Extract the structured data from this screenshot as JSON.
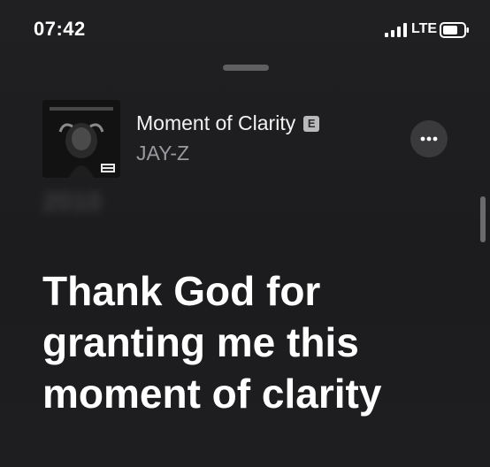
{
  "status_bar": {
    "time": "07:42",
    "network": "LTE",
    "signal_icon": "signal-bars-icon",
    "battery_icon": "battery-icon"
  },
  "now_playing": {
    "title": "Moment of Clarity",
    "explicit_badge": "E",
    "artist": "JAY-Z",
    "artwork_icon": "album-artwork",
    "more_icon": "more-ellipsis-icon"
  },
  "lyrics": {
    "previous_line_blurred": "2010",
    "current_line": "Thank God for granting me this moment of clarity"
  },
  "colors": {
    "background": "#1d1d1f",
    "lyric_active": "#ffffff",
    "artist_text": "#9a9a9e",
    "badge": "#b9b9bc"
  }
}
